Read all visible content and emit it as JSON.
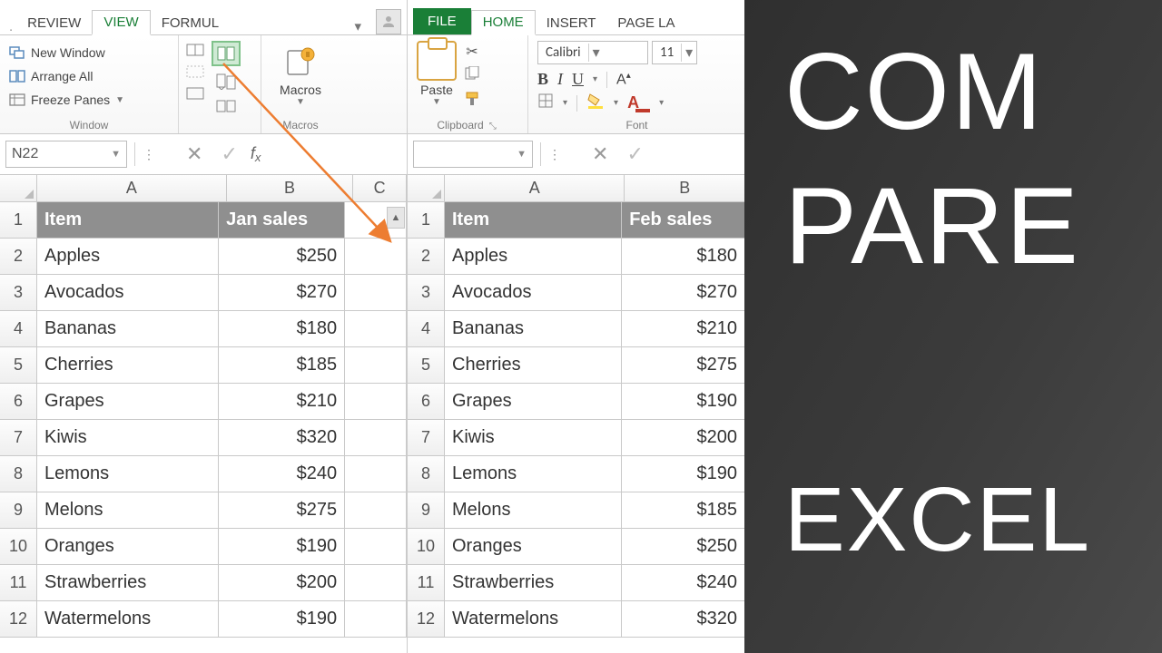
{
  "left": {
    "tabs": [
      "REVIEW",
      "VIEW",
      "FORMUL"
    ],
    "active_tab": "VIEW",
    "window_group": {
      "label": "Window",
      "items": [
        "New Window",
        "Arrange All",
        "Freeze Panes"
      ]
    },
    "macros_group": {
      "label": "Macros",
      "button": "Macros"
    },
    "namebox": "N22",
    "columns": [
      "A",
      "B",
      "C"
    ],
    "header_row": {
      "item": "Item",
      "sales": "Jan sales"
    },
    "rows": [
      {
        "n": 2,
        "item": "Apples",
        "sales": "$250"
      },
      {
        "n": 3,
        "item": "Avocados",
        "sales": "$270"
      },
      {
        "n": 4,
        "item": "Bananas",
        "sales": "$180"
      },
      {
        "n": 5,
        "item": "Cherries",
        "sales": "$185"
      },
      {
        "n": 6,
        "item": "Grapes",
        "sales": "$210"
      },
      {
        "n": 7,
        "item": "Kiwis",
        "sales": "$320"
      },
      {
        "n": 8,
        "item": "Lemons",
        "sales": "$240"
      },
      {
        "n": 9,
        "item": "Melons",
        "sales": "$275"
      },
      {
        "n": 10,
        "item": "Oranges",
        "sales": "$190"
      },
      {
        "n": 11,
        "item": "Strawberries",
        "sales": "$200"
      },
      {
        "n": 12,
        "item": "Watermelons",
        "sales": "$190"
      }
    ]
  },
  "right": {
    "tabs": [
      "FILE",
      "HOME",
      "INSERT",
      "PAGE LA"
    ],
    "active_tab": "HOME",
    "clipboard_label": "Clipboard",
    "paste_label": "Paste",
    "font_label": "Font",
    "font_name": "Calibri",
    "font_size": "11",
    "columns": [
      "A",
      "B"
    ],
    "header_row": {
      "item": "Item",
      "sales": "Feb sales"
    },
    "rows": [
      {
        "n": 2,
        "item": "Apples",
        "sales": "$180"
      },
      {
        "n": 3,
        "item": "Avocados",
        "sales": "$270"
      },
      {
        "n": 4,
        "item": "Bananas",
        "sales": "$210"
      },
      {
        "n": 5,
        "item": "Cherries",
        "sales": "$275"
      },
      {
        "n": 6,
        "item": "Grapes",
        "sales": "$190"
      },
      {
        "n": 7,
        "item": "Kiwis",
        "sales": "$200"
      },
      {
        "n": 8,
        "item": "Lemons",
        "sales": "$190"
      },
      {
        "n": 9,
        "item": "Melons",
        "sales": "$185"
      },
      {
        "n": 10,
        "item": "Oranges",
        "sales": "$250"
      },
      {
        "n": 11,
        "item": "Strawberries",
        "sales": "$240"
      },
      {
        "n": 12,
        "item": "Watermelons",
        "sales": "$320"
      }
    ]
  },
  "overlay": {
    "line1": "COM",
    "line2": "PARE",
    "line3": "EXCEL"
  },
  "colors": {
    "accent": "#1a7f37",
    "highlight": "#cfead4",
    "arrow": "#ed7d31"
  }
}
